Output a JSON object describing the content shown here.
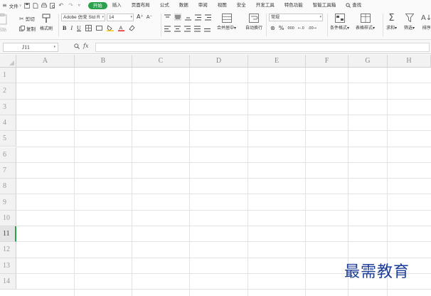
{
  "menubar": {
    "file_label": "文件",
    "tabs": [
      {
        "label": "开始",
        "active": true
      },
      {
        "label": "插入"
      },
      {
        "label": "页面布局"
      },
      {
        "label": "公式"
      },
      {
        "label": "数据"
      },
      {
        "label": "审阅"
      },
      {
        "label": "视图"
      },
      {
        "label": "安全"
      },
      {
        "label": "开发工具"
      },
      {
        "label": "特色功能"
      },
      {
        "label": "智能工具箱"
      }
    ],
    "search_label": "查找",
    "accent_color": "#2aa24c"
  },
  "ribbon": {
    "cut_label": "剪切",
    "paste_label": "粘贴",
    "copy_label": "复制",
    "format_painter_label": "格式刷",
    "font_name": "Adobe 仿宋 Std R",
    "font_size": "14",
    "bold_label": "B",
    "italic_label": "I",
    "underline_label": "U",
    "grow_font_label": "A⁺",
    "shrink_font_label": "A⁻",
    "merge_center_label": "合并居中",
    "wrap_text_label": "自动换行",
    "number_format": "常规",
    "percent_label": "%",
    "thousands_label": "000",
    "conditional_format_label": "条件格式",
    "table_style_label": "表格样式",
    "sum_label": "求和",
    "filter_label": "筛选",
    "sort_label": "排序"
  },
  "formula_bar": {
    "cell_reference": "J11",
    "fx_label": "fx",
    "formula_value": ""
  },
  "grid": {
    "columns": [
      "A",
      "B",
      "C",
      "D",
      "E",
      "F",
      "G",
      "H"
    ],
    "rows": [
      "1",
      "2",
      "3",
      "4",
      "5",
      "6",
      "7",
      "8",
      "9",
      "10",
      "11",
      "12",
      "13",
      "14"
    ],
    "active_row": "11",
    "active_color": "#2aa24c"
  },
  "watermark": {
    "text": "最需教育",
    "color": "#1b3d97"
  }
}
